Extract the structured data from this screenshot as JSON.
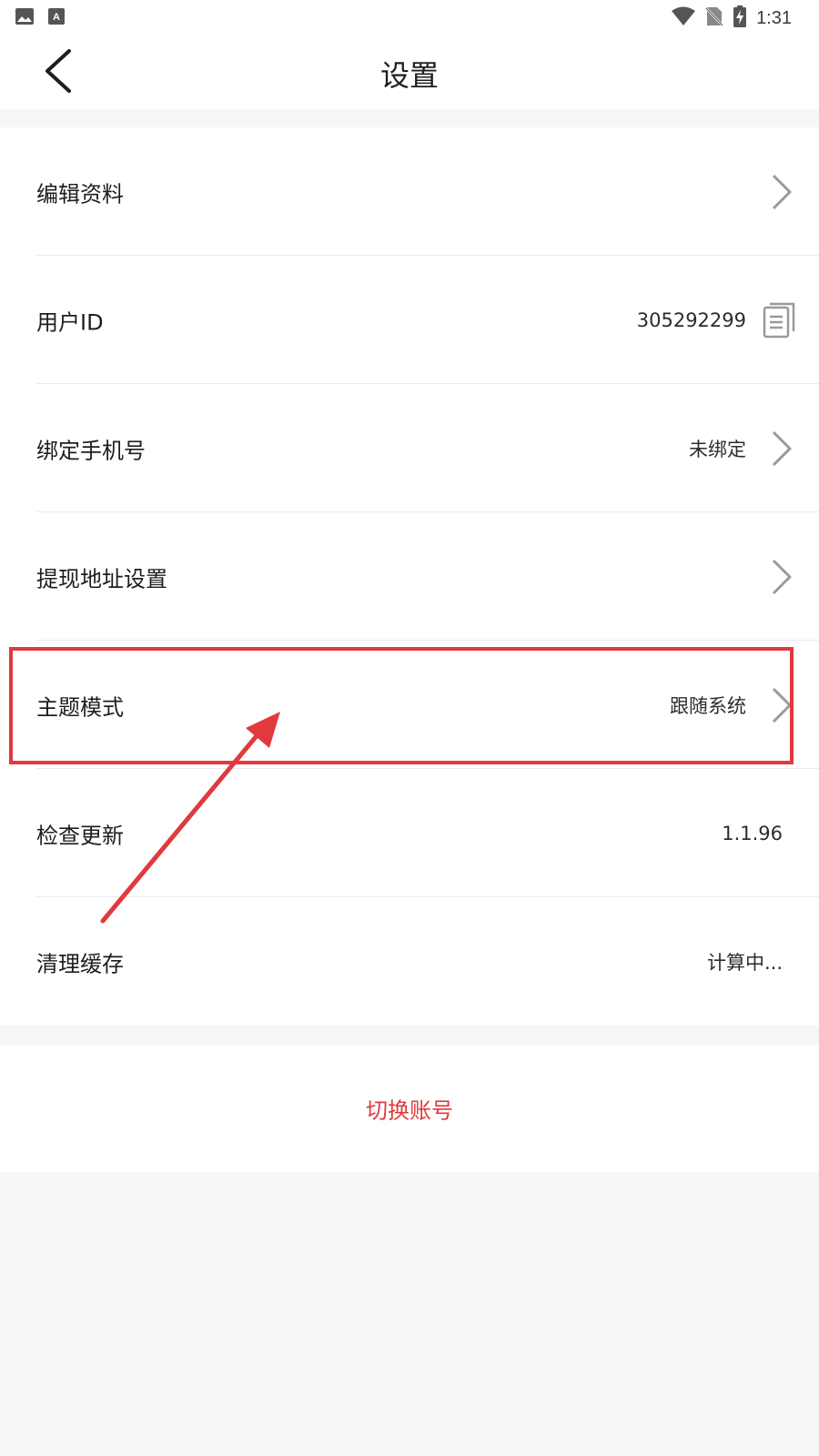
{
  "status_bar": {
    "time": "1:31",
    "left_icons": [
      "image-icon",
      "text-a-icon"
    ],
    "right_icons": [
      "wifi-icon",
      "no-sim-icon",
      "battery-charging-icon"
    ]
  },
  "header": {
    "title": "设置",
    "back_icon": "back-chevron-icon"
  },
  "settings": [
    {
      "id": "edit-profile",
      "label": "编辑资料",
      "value": "",
      "trailing": "chevron"
    },
    {
      "id": "user-id",
      "label": "用户ID",
      "value": "305292299",
      "trailing": "copy"
    },
    {
      "id": "bind-phone",
      "label": "绑定手机号",
      "value": "未绑定",
      "trailing": "chevron"
    },
    {
      "id": "withdraw-address",
      "label": "提现地址设置",
      "value": "",
      "trailing": "chevron"
    },
    {
      "id": "theme-mode",
      "label": "主题模式",
      "value": "跟随系统",
      "trailing": "chevron"
    },
    {
      "id": "check-update",
      "label": "检查更新",
      "value": "1.1.96",
      "trailing": "none"
    },
    {
      "id": "clear-cache",
      "label": "清理缓存",
      "value": "计算中...",
      "trailing": "none"
    }
  ],
  "switch_account": {
    "label": "切换账号",
    "color": "#e0393e"
  },
  "annotation": {
    "highlight_color": "#e0393e",
    "highlighted_item": "theme-mode"
  },
  "colors": {
    "background": "#f5f6f6",
    "surface": "#ffffff",
    "chevron": "#9a9a9a",
    "divider": "#ebebeb"
  }
}
